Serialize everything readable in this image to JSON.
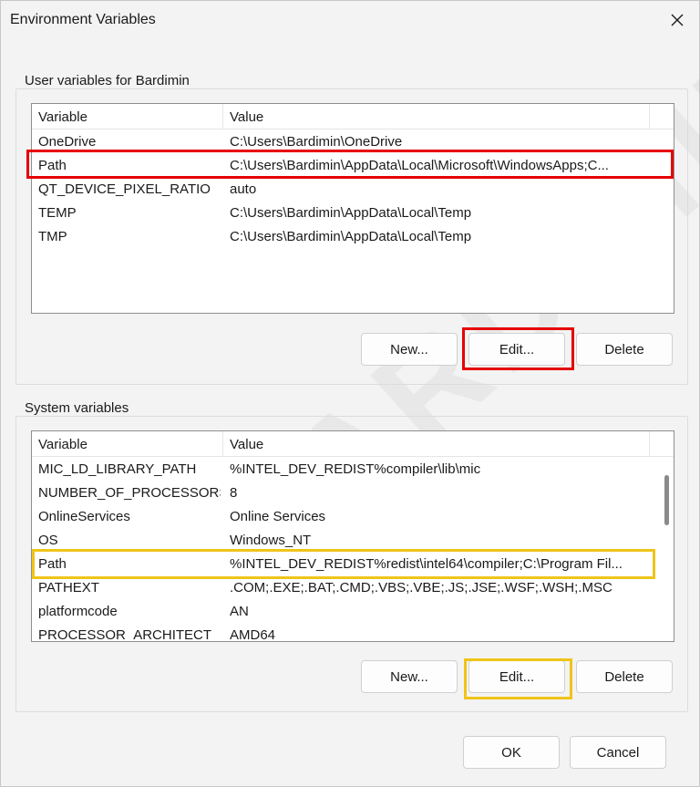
{
  "window": {
    "title": "Environment Variables"
  },
  "user_group": {
    "label": "User variables for Bardimin",
    "headers": {
      "variable": "Variable",
      "value": "Value"
    },
    "rows": [
      {
        "name": "OneDrive",
        "value": "C:\\Users\\Bardimin\\OneDrive"
      },
      {
        "name": "Path",
        "value": "C:\\Users\\Bardimin\\AppData\\Local\\Microsoft\\WindowsApps;C..."
      },
      {
        "name": "QT_DEVICE_PIXEL_RATIO",
        "value": "auto"
      },
      {
        "name": "TEMP",
        "value": "C:\\Users\\Bardimin\\AppData\\Local\\Temp"
      },
      {
        "name": "TMP",
        "value": "C:\\Users\\Bardimin\\AppData\\Local\\Temp"
      }
    ],
    "buttons": {
      "new": "New...",
      "edit": "Edit...",
      "delete": "Delete"
    }
  },
  "system_group": {
    "label": "System variables",
    "headers": {
      "variable": "Variable",
      "value": "Value"
    },
    "rows": [
      {
        "name": "MIC_LD_LIBRARY_PATH",
        "value": "%INTEL_DEV_REDIST%compiler\\lib\\mic"
      },
      {
        "name": "NUMBER_OF_PROCESSORS",
        "value": "8"
      },
      {
        "name": "OnlineServices",
        "value": "Online Services"
      },
      {
        "name": "OS",
        "value": "Windows_NT"
      },
      {
        "name": "Path",
        "value": "%INTEL_DEV_REDIST%redist\\intel64\\compiler;C:\\Program Fil..."
      },
      {
        "name": "PATHEXT",
        "value": ".COM;.EXE;.BAT;.CMD;.VBS;.VBE;.JS;.JSE;.WSF;.WSH;.MSC"
      },
      {
        "name": "platformcode",
        "value": "AN"
      },
      {
        "name": "PROCESSOR_ARCHITECT",
        "value": "AMD64"
      }
    ],
    "buttons": {
      "new": "New...",
      "edit": "Edit...",
      "delete": "Delete"
    }
  },
  "footer": {
    "ok": "OK",
    "cancel": "Cancel"
  },
  "watermark": "BARDIMIN",
  "colors": {
    "highlight_red": "#e60000",
    "highlight_yellow": "#f0c419"
  }
}
